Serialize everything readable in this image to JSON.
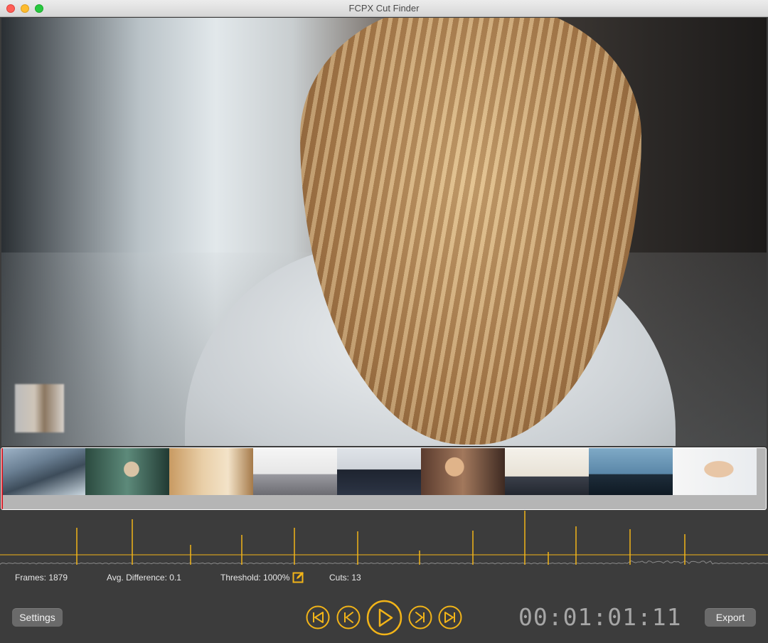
{
  "window": {
    "title": "FCPX Cut Finder"
  },
  "filmstrip": {
    "frames": [
      "skyscraper-exterior",
      "man-at-desk",
      "office-interior",
      "laptop-typing",
      "business-group",
      "woman-working",
      "paperwork-signing",
      "team-silhouettes",
      "handshake"
    ]
  },
  "stats": {
    "frames": "Frames: 1879",
    "avg_difference": "Avg. Difference: 0.1",
    "threshold": "Threshold: 1000%",
    "cuts": "Cuts: 13"
  },
  "controls": {
    "settings_label": "Settings",
    "export_label": "Export",
    "timecode": "00:01:01:11"
  },
  "colors": {
    "accent": "#f2b418",
    "playhead": "#d8202a",
    "background": "#3c3c3c"
  },
  "icons": {
    "threshold_edit": "edit-icon",
    "go_to_start": "skip-to-start-icon",
    "previous": "previous-icon",
    "play": "play-icon",
    "next": "next-icon",
    "go_to_end": "skip-to-end-icon"
  }
}
